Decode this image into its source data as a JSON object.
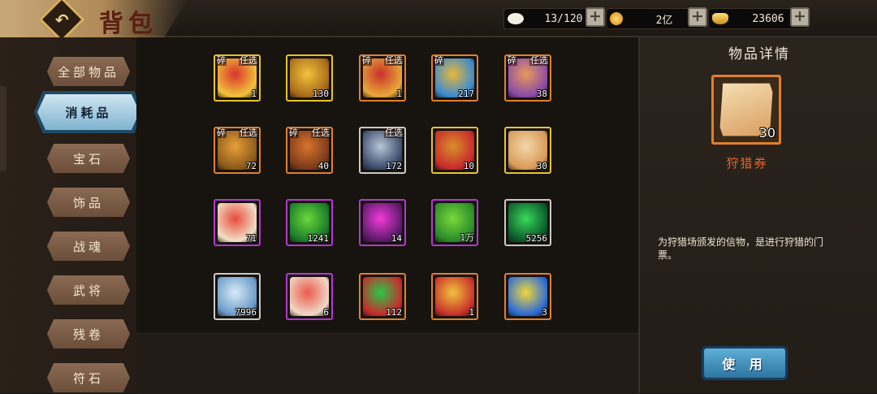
{
  "header": {
    "back_icon": "back-arrow-icon",
    "title": "背包",
    "resources": [
      {
        "name": "bag-capacity",
        "icon": "bun-icon",
        "value": "13/120",
        "color": "#f2efe4"
      },
      {
        "name": "coins",
        "icon": "coin-icon",
        "value": "2亿",
        "color": "#f0b52c"
      },
      {
        "name": "ingots",
        "icon": "ingot-icon",
        "value": "23606",
        "color": "#f0c43c"
      }
    ],
    "plus_label": "+"
  },
  "menu": {
    "items": [
      {
        "label": "全部物品"
      },
      {
        "label": "消耗品",
        "active": true
      },
      {
        "label": "宝石"
      },
      {
        "label": "饰品"
      },
      {
        "label": "战魂"
      },
      {
        "label": "武将"
      },
      {
        "label": "残卷"
      },
      {
        "label": "符石"
      }
    ]
  },
  "items": [
    {
      "icon": "red-gold-chest-icon",
      "count": "1",
      "quality": "gold",
      "tag_left": "碎",
      "tag_right": "任选",
      "colors": [
        "#d8322c",
        "#f2c43c"
      ]
    },
    {
      "icon": "gold-chest-icon",
      "count": "130",
      "quality": "gold",
      "colors": [
        "#f2c43c",
        "#a86a1a"
      ]
    },
    {
      "icon": "red-chest-icon",
      "count": "1",
      "quality": "orange",
      "tag_left": "碎",
      "tag_right": "任选",
      "colors": [
        "#c8302a",
        "#e8a83a"
      ]
    },
    {
      "icon": "blue-gold-chest-icon",
      "count": "217",
      "quality": "orange",
      "tag_left": "碎",
      "colors": [
        "#e8b83a",
        "#3a8ad0"
      ]
    },
    {
      "icon": "purple-chest-icon",
      "count": "38",
      "quality": "orange",
      "tag_left": "碎",
      "tag_right": "任选",
      "colors": [
        "#e89a5a",
        "#8a4aa8"
      ]
    },
    {
      "icon": "wooden-chest-icon",
      "count": "72",
      "quality": "orange",
      "tag_left": "碎",
      "tag_right": "任选",
      "colors": [
        "#e8a03a",
        "#8a5a1a"
      ]
    },
    {
      "icon": "brown-chest-icon",
      "count": "40",
      "quality": "orange",
      "tag_left": "碎",
      "tag_right": "任选",
      "colors": [
        "#d8742c",
        "#7a3a1a"
      ]
    },
    {
      "icon": "silver-chest-icon",
      "count": "172",
      "quality": "white",
      "tag_right": "任选",
      "colors": [
        "#b8c4d8",
        "#3a4a6a"
      ]
    },
    {
      "icon": "shield-token-icon",
      "count": "10",
      "quality": "gold",
      "colors": [
        "#d8902c",
        "#c82a2a"
      ]
    },
    {
      "icon": "scroll-ticket-icon",
      "count": "30",
      "quality": "gold",
      "colors": [
        "#f2d8a8",
        "#d89a5a"
      ]
    },
    {
      "icon": "shirt-fragment-icon",
      "count": "71",
      "quality": "purple",
      "colors": [
        "#e84a3a",
        "#f2e0c8"
      ]
    },
    {
      "icon": "green-orb-icon",
      "count": "1241",
      "quality": "purple",
      "colors": [
        "#6ad83a",
        "#1a7a2a"
      ]
    },
    {
      "icon": "magenta-orb-icon",
      "count": "14",
      "quality": "purple",
      "colors": [
        "#f23ad8",
        "#5a1a6a"
      ]
    },
    {
      "icon": "paw-orb-icon",
      "count": "1万",
      "quality": "purple",
      "colors": [
        "#7ad83a",
        "#2a8a2a"
      ]
    },
    {
      "icon": "green-gem-icon",
      "count": "5256",
      "quality": "white",
      "colors": [
        "#3ad85a",
        "#0a5a2a"
      ]
    },
    {
      "icon": "crystal-icon",
      "count": "7996",
      "quality": "white",
      "colors": [
        "#d8ecf8",
        "#6a9ac8"
      ]
    },
    {
      "icon": "red-scroll-icon",
      "count": "6",
      "quality": "purple",
      "colors": [
        "#e85a4a",
        "#f2d8c8"
      ]
    },
    {
      "icon": "jade-pendant-icon",
      "count": "112",
      "quality": "orange",
      "colors": [
        "#2ac84a",
        "#c82a2a"
      ]
    },
    {
      "icon": "golden-bell-icon",
      "count": "1",
      "quality": "orange",
      "colors": [
        "#f2c43c",
        "#c8302a"
      ]
    },
    {
      "icon": "star-medal-icon",
      "count": "3",
      "quality": "orange",
      "colors": [
        "#f2d83a",
        "#2a6ad8"
      ]
    }
  ],
  "detail": {
    "heading": "物品详情",
    "icon": "scroll-ticket-icon",
    "count": "30",
    "name": "狩猎券",
    "description": "为狩猎场颁发的信物，是进行狩猎的门票。",
    "use_label": "使 用"
  }
}
